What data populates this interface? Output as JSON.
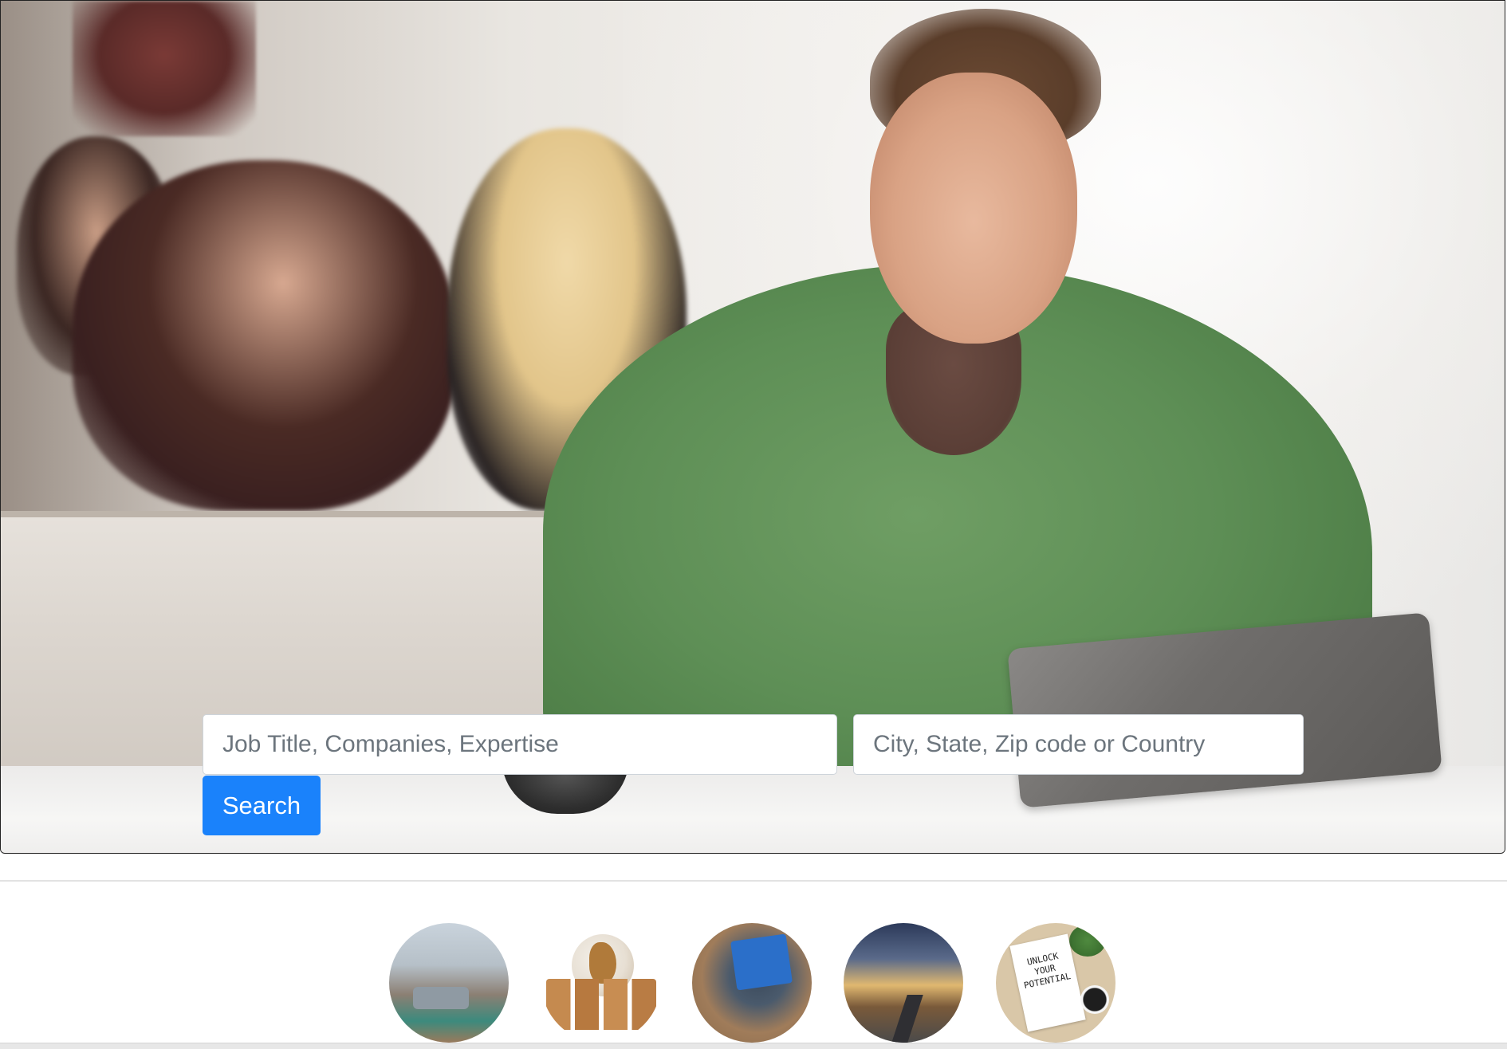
{
  "hero": {
    "image_alt": "Man in green sweater using a tablet in a café"
  },
  "search": {
    "job_placeholder": "Job Title, Companies, Expertise",
    "location_placeholder": "City, State, Zip code or Country",
    "button_label": "Search",
    "button_color": "#1a82fb"
  },
  "categories": [
    {
      "name": "apartment-interior"
    },
    {
      "name": "globe-with-boxes"
    },
    {
      "name": "laptop-desk"
    },
    {
      "name": "open-road"
    },
    {
      "name": "unlock-your-potential",
      "note_text": "UNLOCK\nYOUR\nPOTENTIAL"
    }
  ]
}
